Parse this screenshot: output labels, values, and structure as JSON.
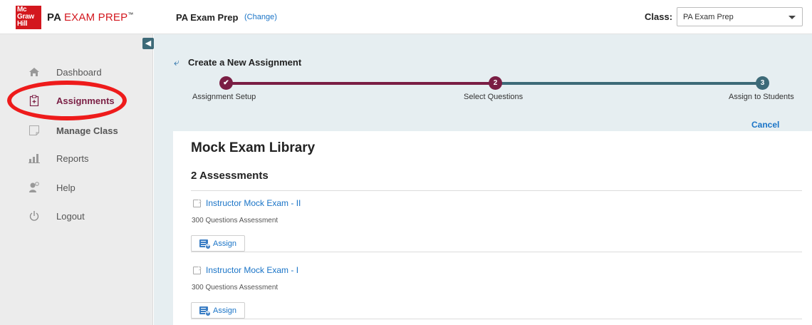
{
  "header": {
    "logo_lines": [
      "Mc",
      "Graw",
      "Hill"
    ],
    "brand_bold": "PA",
    "brand_light": "EXAM PREP",
    "brand_mark": "™",
    "course_name": "PA Exam Prep",
    "course_change": "(Change)",
    "class_label": "Class:",
    "class_selected": "PA Exam Prep"
  },
  "sidebar": {
    "items": [
      {
        "label": "Dashboard",
        "icon": "home-icon"
      },
      {
        "label": "Assignments",
        "icon": "clipboard-plus-icon"
      },
      {
        "label": "Manage Class",
        "icon": "notepad-icon"
      },
      {
        "label": "Reports",
        "icon": "bar-chart-icon"
      },
      {
        "label": "Help",
        "icon": "person-help-icon"
      },
      {
        "label": "Logout",
        "icon": "power-icon"
      }
    ]
  },
  "wizard": {
    "title": "Create a New Assignment",
    "steps": [
      {
        "number": "✔",
        "label": "Assignment Setup"
      },
      {
        "number": "2",
        "label": "Select Questions"
      },
      {
        "number": "3",
        "label": "Assign to Students"
      }
    ],
    "cancel": "Cancel"
  },
  "library": {
    "title": "Mock Exam Library",
    "count": "2 Assessments",
    "items": [
      {
        "title": "Instructor Mock Exam - II",
        "subtitle": "300 Questions Assessment",
        "button": "Assign"
      },
      {
        "title": "Instructor Mock Exam - I",
        "subtitle": "300 Questions Assessment",
        "button": "Assign"
      }
    ]
  },
  "colors": {
    "accent_maroon": "#7a1e44",
    "accent_teal": "#3d6a78",
    "link_blue": "#1a74c7",
    "annotation_red": "#ee1b1b",
    "logo_red": "#d3171e"
  }
}
